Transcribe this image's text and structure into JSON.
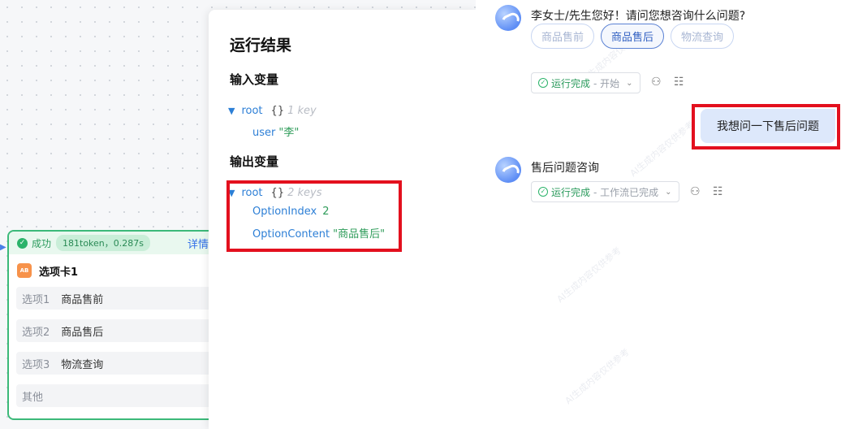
{
  "node": {
    "status": "成功",
    "tokens": "181token，0.287s",
    "detail": "详情",
    "icon_text": "AB",
    "title": "选项卡1",
    "options": [
      {
        "label": "选项1",
        "value": "商品售前"
      },
      {
        "label": "选项2",
        "value": "商品售后"
      },
      {
        "label": "选项3",
        "value": "物流查询"
      },
      {
        "label": "其他",
        "value": ""
      }
    ]
  },
  "result": {
    "title": "运行结果",
    "input_title": "输入变量",
    "output_title": "输出变量",
    "input": {
      "root": "root",
      "brace": "{}",
      "meta": "1 key",
      "key": "user",
      "value": "\"李\""
    },
    "output": {
      "root": "root",
      "brace": "{}",
      "meta": "2 keys",
      "key1": "OptionIndex",
      "value1": "2",
      "key2": "OptionContent",
      "value2": "\"商品售后\""
    }
  },
  "chat": {
    "greeting": "李女士/先生您好！请问您想咨询什么问题?",
    "chips": [
      "商品售前",
      "商品售后",
      "物流查询"
    ],
    "run1": {
      "done": "运行完成",
      "sub": "- 开始"
    },
    "user_message": "我想问一下售后问题",
    "reply": "售后问题咨询",
    "run2": {
      "done": "运行完成",
      "sub": "- 工作流已完成"
    }
  },
  "colors": {
    "success": "#2bb36a",
    "accent": "#3370e8",
    "highlight": "#e3101e"
  }
}
